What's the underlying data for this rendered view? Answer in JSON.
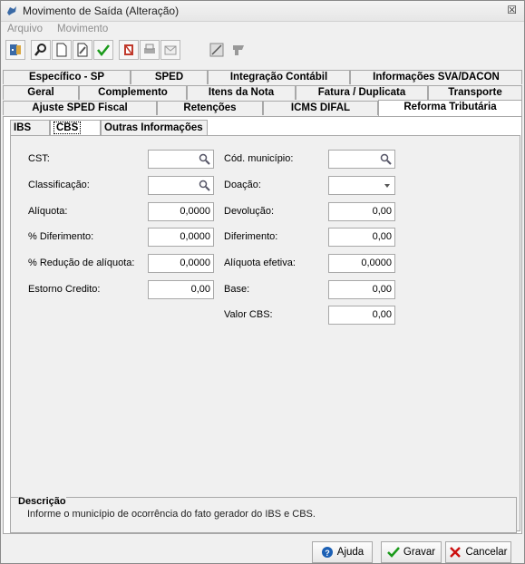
{
  "window": {
    "title": "Movimento de Saída (Alteração)",
    "close_glyph": "☒"
  },
  "menu": {
    "items": [
      "Arquivo",
      "Movimento"
    ]
  },
  "toolbar": {
    "icons": [
      "exit-icon",
      "search-icon",
      "new-doc-icon",
      "edit-doc-icon",
      "confirm-icon",
      "delete-icon",
      "print-icon",
      "email-icon",
      "calculator-icon",
      "transfer-icon"
    ]
  },
  "tabs": {
    "row1": [
      "Específico - SP",
      "SPED",
      "Integração Contábil",
      "Informações SVA/DACON"
    ],
    "row2": [
      "Geral",
      "Complemento",
      "Itens da Nota",
      "Fatura / Duplicata",
      "Transporte"
    ],
    "row3": [
      "Ajuste SPED Fiscal",
      "Retenções",
      "ICMS DIFAL",
      "Reforma Tributária"
    ]
  },
  "subtabs": [
    "IBS",
    "CBS",
    "Outras Informações"
  ],
  "form": {
    "left": {
      "cst_label": "CST:",
      "classificacao_label": "Classificação:",
      "aliquota_label": "Alíquota:",
      "aliquota_value": "0,0000",
      "diferimento_pct_label": "% Diferimento:",
      "diferimento_pct_value": "0,0000",
      "reducao_label": "% Redução de alíquota:",
      "reducao_value": "0,0000",
      "estorno_label": "Estorno Credito:",
      "estorno_value": "0,00"
    },
    "right": {
      "cod_municipio_label": "Cód. município:",
      "doacao_label": "Doação:",
      "devolucao_label": "Devolução:",
      "devolucao_value": "0,00",
      "diferimento_label": "Diferimento:",
      "diferimento_value": "0,00",
      "aliquota_efetiva_label": "Alíquota efetiva:",
      "aliquota_efetiva_value": "0,0000",
      "base_label": "Base:",
      "base_value": "0,00",
      "valor_cbs_label": "Valor CBS:",
      "valor_cbs_value": "0,00"
    }
  },
  "description": {
    "legend": "Descrição",
    "text": "Informe o município de ocorrência do fato gerador do IBS e CBS."
  },
  "buttons": {
    "help": "Ajuda",
    "save": "Gravar",
    "cancel": "Cancelar"
  },
  "colors": {
    "accent": "#1b5fb4",
    "confirm": "#1a9a1a",
    "cancel": "#cc1111"
  }
}
